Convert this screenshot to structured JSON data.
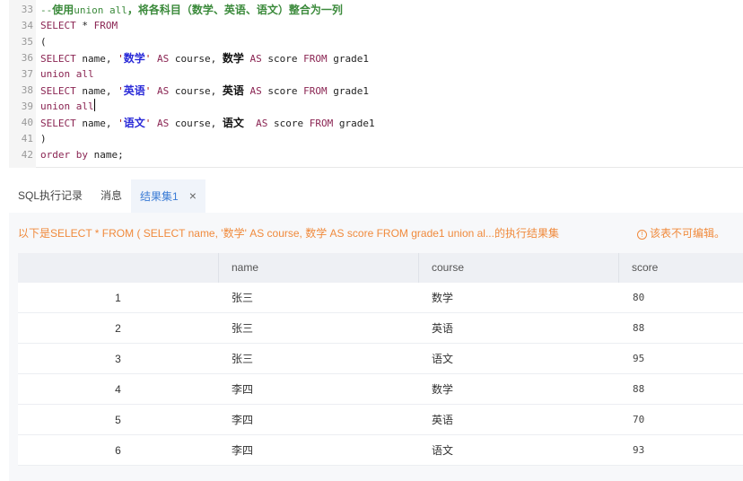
{
  "editor": {
    "lines": [
      {
        "num": "33",
        "parts": [
          [
            "comment",
            "--"
          ],
          [
            "cjk-comment",
            "使用"
          ],
          [
            "comment",
            "union all"
          ],
          [
            "cjk-comment",
            "，将各科目（数学、英语、语文）整合为一列"
          ]
        ]
      },
      {
        "num": "34",
        "parts": [
          [
            "kw",
            "SELECT"
          ],
          [
            "plain",
            " * "
          ],
          [
            "kw",
            "FROM"
          ]
        ]
      },
      {
        "num": "35",
        "parts": [
          [
            "plain",
            "("
          ]
        ]
      },
      {
        "num": "36",
        "parts": [
          [
            "kw",
            "SELECT"
          ],
          [
            "plain",
            " name, "
          ],
          [
            "str",
            "'"
          ],
          [
            "cjk-str",
            "数学"
          ],
          [
            "str",
            "'"
          ],
          [
            "plain",
            " "
          ],
          [
            "kw",
            "AS"
          ],
          [
            "plain",
            " course, "
          ],
          [
            "cjk-bold",
            "数学"
          ],
          [
            "plain",
            " "
          ],
          [
            "kw",
            "AS"
          ],
          [
            "plain",
            " score "
          ],
          [
            "kw",
            "FROM"
          ],
          [
            "plain",
            " grade1"
          ]
        ]
      },
      {
        "num": "37",
        "parts": [
          [
            "kw",
            "union all"
          ]
        ]
      },
      {
        "num": "38",
        "parts": [
          [
            "kw",
            "SELECT"
          ],
          [
            "plain",
            " name, "
          ],
          [
            "str",
            "'"
          ],
          [
            "cjk-str",
            "英语"
          ],
          [
            "str",
            "'"
          ],
          [
            "plain",
            " "
          ],
          [
            "kw",
            "AS"
          ],
          [
            "plain",
            " course, "
          ],
          [
            "cjk-bold",
            "英语"
          ],
          [
            "plain",
            " "
          ],
          [
            "kw",
            "AS"
          ],
          [
            "plain",
            " score "
          ],
          [
            "kw",
            "FROM"
          ],
          [
            "plain",
            " grade1"
          ]
        ]
      },
      {
        "num": "39",
        "parts": [
          [
            "kw",
            "union all"
          ]
        ],
        "cursor": true
      },
      {
        "num": "40",
        "parts": [
          [
            "kw",
            "SELECT"
          ],
          [
            "plain",
            " name, "
          ],
          [
            "str",
            "'"
          ],
          [
            "cjk-str",
            "语文"
          ],
          [
            "str",
            "'"
          ],
          [
            "plain",
            " "
          ],
          [
            "kw",
            "AS"
          ],
          [
            "plain",
            " course, "
          ],
          [
            "cjk-bold",
            "语文"
          ],
          [
            "plain",
            "  "
          ],
          [
            "kw",
            "AS"
          ],
          [
            "plain",
            " score "
          ],
          [
            "kw",
            "FROM"
          ],
          [
            "plain",
            " grade1"
          ]
        ]
      },
      {
        "num": "41",
        "parts": [
          [
            "plain",
            ")"
          ]
        ]
      },
      {
        "num": "42",
        "parts": [
          [
            "kw",
            "order by"
          ],
          [
            "plain",
            " name;"
          ]
        ]
      }
    ]
  },
  "tabs": {
    "history_label": "SQL执行记录",
    "messages_label": "消息",
    "result_label": "结果集1",
    "close_glyph": "×"
  },
  "result": {
    "notice": "以下是SELECT * FROM ( SELECT name, '数学' AS course, 数学 AS score FROM grade1 union al...的执行结果集",
    "readonly_icon": "!",
    "readonly_text": "该表不可编辑。",
    "columns": [
      "name",
      "course",
      "score"
    ],
    "rows": [
      {
        "idx": "1",
        "name": "张三",
        "course": "数学",
        "score": "80"
      },
      {
        "idx": "2",
        "name": "张三",
        "course": "英语",
        "score": "88"
      },
      {
        "idx": "3",
        "name": "张三",
        "course": "语文",
        "score": "95"
      },
      {
        "idx": "4",
        "name": "李四",
        "course": "数学",
        "score": "88"
      },
      {
        "idx": "5",
        "name": "李四",
        "course": "英语",
        "score": "70"
      },
      {
        "idx": "6",
        "name": "李四",
        "course": "语文",
        "score": "93"
      }
    ]
  },
  "colors": {
    "keyword": "#8a2452",
    "comment": "#3b8a3b",
    "notice": "#f08a3c",
    "active_tab": "#3a7bd5"
  }
}
